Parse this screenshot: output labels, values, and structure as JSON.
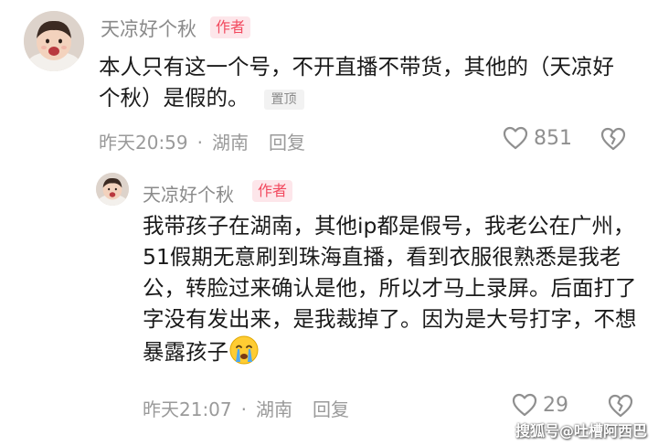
{
  "comment": {
    "username": "天凉好个秋",
    "author_badge": "作者",
    "text": "本人只有这一个号，不开直播不带货，其他的（天凉好个秋）是假的。",
    "pinned_label": "置顶",
    "time": "昨天20:59",
    "location": "湖南",
    "separator": "·",
    "reply_label": "回复",
    "like_count": "851"
  },
  "reply": {
    "username": "天凉好个秋",
    "author_badge": "作者",
    "text": "我带孩子在湖南，其他ip都是假号，我老公在广州，51假期无意刷到珠海直播，看到衣服很熟悉是我老公，转脸过来确认是他，所以才马上录屏。后面打了字没有发出来，是我裁掉了。因为是大号打字，不想暴露孩子",
    "time": "昨天21:07",
    "location": "湖南",
    "separator": "·",
    "reply_label": "回复",
    "like_count": "29"
  },
  "icons": {
    "like": "heart-outline-icon",
    "dislike": "broken-heart-icon",
    "emoji": "crying-face-emoji"
  },
  "watermark": "搜狐号@吐槽阿西巴",
  "colors": {
    "author_badge_bg": "#fde6ea",
    "author_badge_text": "#f24a5f",
    "meta_text": "#9a9a9a"
  }
}
